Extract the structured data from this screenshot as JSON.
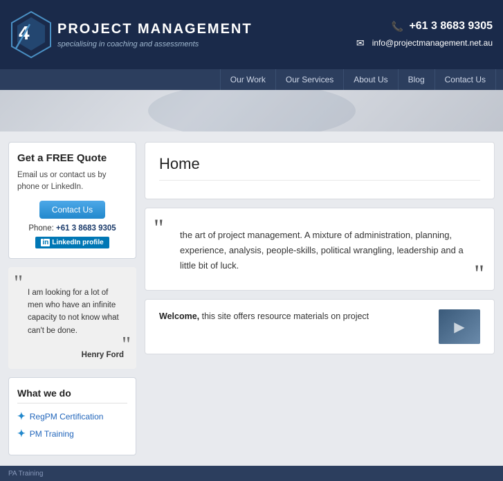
{
  "header": {
    "logo_title": "Project Management",
    "logo_subtitle": "specialising in coaching and assessments",
    "phone": "+61 3 8683 9305",
    "email": "info@projectmanagement.net.au"
  },
  "nav": {
    "items": [
      {
        "label": "Our Work",
        "id": "our-work"
      },
      {
        "label": "Our Services",
        "id": "our-services"
      },
      {
        "label": "About Us",
        "id": "about-us"
      },
      {
        "label": "Blog",
        "id": "blog"
      },
      {
        "label": "Contact Us",
        "id": "contact-us"
      }
    ]
  },
  "sidebar": {
    "quote_box": {
      "title": "Get a FREE Quote",
      "description": "Email us or contact us by phone or LinkedIn.",
      "button_label": "Contact Us",
      "phone_label": "Phone:",
      "phone_number": "+61 3 8683 9305",
      "linkedin_label": "LinkedIn profile"
    },
    "testimonial": {
      "text": "I am looking for a lot of men who have an infinite capacity to not know what can't be done.",
      "author": "Henry Ford"
    },
    "what_we_do": {
      "title": "What we do",
      "items": [
        {
          "label": "RegPM Certification",
          "id": "regpm"
        },
        {
          "label": "PM Training",
          "id": "pm-training"
        }
      ]
    }
  },
  "content": {
    "page_title": "Home",
    "quote": "the art of project management. A mixture of administration, planning, experience, analysis, people-skills, political wrangling, leadership and a little bit of luck.",
    "welcome_label": "Welcome,",
    "welcome_text": "this site offers resource materials on project"
  },
  "footer": {
    "text": "PA Training"
  },
  "colors": {
    "header_bg": "#1a2a4a",
    "nav_bg": "#2c3e5e",
    "accent": "#2288cc",
    "link": "#2266bb"
  }
}
